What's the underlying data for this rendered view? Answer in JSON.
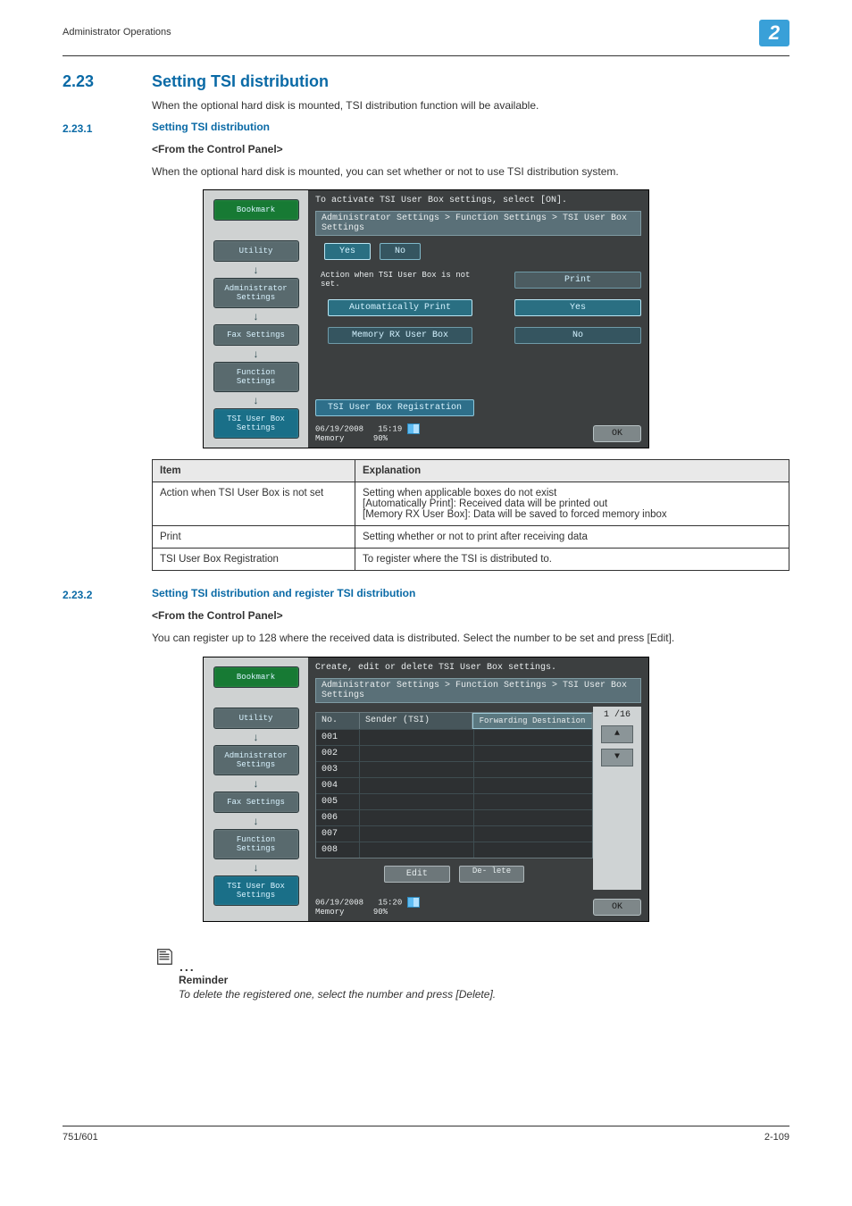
{
  "header": {
    "section": "Administrator Operations",
    "chapter": "2"
  },
  "h1": {
    "num": "2.23",
    "title": "Setting TSI distribution"
  },
  "intro1": "When the optional hard disk is mounted, TSI distribution function will be available.",
  "h2a": {
    "num": "2.23.1",
    "title": "Setting TSI distribution"
  },
  "sub1_head": "<From the Control Panel>",
  "sub1_text": "When the optional hard disk is mounted, you can set whether or not to use TSI distribution system.",
  "nav": {
    "bookmark": "Bookmark",
    "utility": "Utility",
    "admin": "Administrator Settings",
    "fax": "Fax Settings",
    "func": "Function Settings",
    "tsi": "TSI User Box Settings"
  },
  "screen1": {
    "top_msg": "To activate TSI User Box settings, select [ON].",
    "breadcrumb": "Administrator Settings > Function Settings > TSI User Box Settings",
    "yes": "Yes",
    "no": "No",
    "row1_label": "Action when TSI User Box is not set.",
    "row1_right": "Print",
    "row2_left": "Automatically Print",
    "row2_right": "Yes",
    "row3_left": "Memory RX User Box",
    "row3_right": "No",
    "reg_btn": "TSI User Box Registration",
    "date": "06/19/2008",
    "time": "15:19",
    "mem_lbl": "Memory",
    "mem_pct": "90%",
    "ok": "OK"
  },
  "expl": {
    "h_item": "Item",
    "h_expl": "Explanation",
    "r1_a": "Action when TSI User Box is not set",
    "r1_b": "Setting when applicable boxes do not exist\n[Automatically Print]: Received data will be printed out\n[Memory RX User Box]: Data will be saved to forced memory inbox",
    "r2_a": "Print",
    "r2_b": "Setting whether or not to print after receiving data",
    "r3_a": "TSI User Box Registration",
    "r3_b": "To register where the TSI is distributed to."
  },
  "h2b": {
    "num": "2.23.2",
    "title": "Setting TSI distribution and register TSI distribution"
  },
  "sub2_head": "<From the Control Panel>",
  "sub2_text": "You can register up to 128 where the received data is distributed. Select the number to be set and press [Edit].",
  "screen2": {
    "top_msg": "Create, edit or delete TSI User Box settings.",
    "breadcrumb": "Administrator Settings > Function Settings > TSI User Box Settings",
    "col_no": "No.",
    "col_sender": "Sender (TSI)",
    "col_dest": "Forwarding Destination",
    "rows": [
      "001",
      "002",
      "003",
      "004",
      "005",
      "006",
      "007",
      "008"
    ],
    "page": "1 /16",
    "edit": "Edit",
    "delete": "De- lete",
    "date": "06/19/2008",
    "time": "15:20",
    "mem_lbl": "Memory",
    "mem_pct": "90%",
    "ok": "OK"
  },
  "reminder": {
    "title": "Reminder",
    "text": "To delete the registered one, select the number and press [Delete]."
  },
  "footer": {
    "left": "751/601",
    "right": "2-109"
  }
}
